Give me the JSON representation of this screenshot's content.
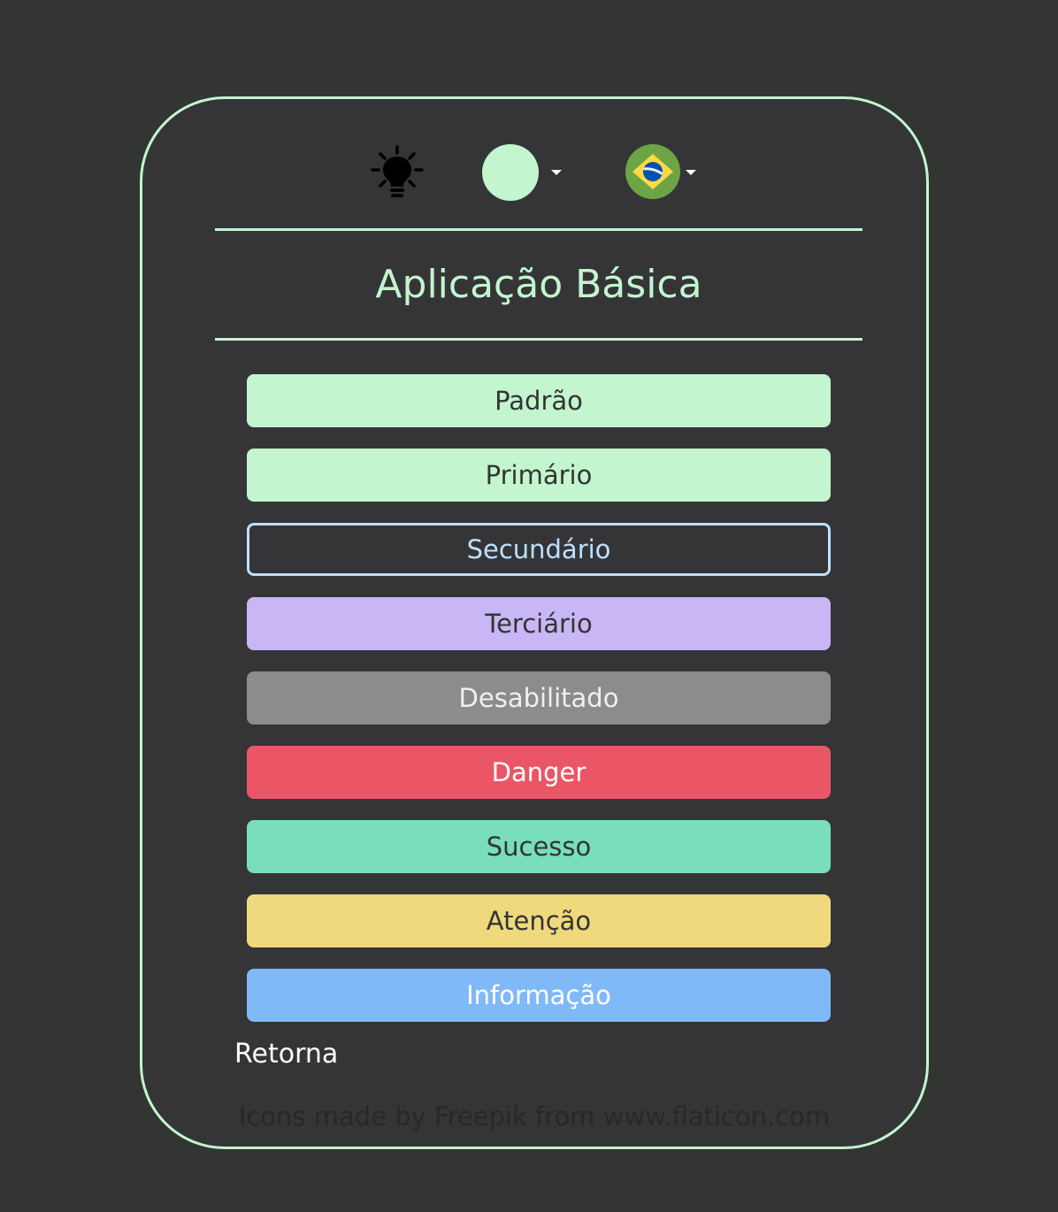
{
  "colors": {
    "background": "#333532",
    "card": "#353537",
    "accent": "#c3f5cf",
    "secondary": "#bde0fe",
    "tertiary": "#c8b6f5",
    "disabled": "#8c8c8e",
    "danger": "#ea5666",
    "success": "#78debb",
    "warning": "#f0d87c",
    "info": "#80b9f8"
  },
  "toolbar": {
    "light_icon": "lightbulb-icon",
    "theme_icon": "theme-color-circle-icon",
    "language_icon": "brazil-flag-icon",
    "dropdown_icon": "caret-down-icon"
  },
  "header": {
    "title": "Aplicação Básica"
  },
  "buttons": {
    "default": "Padrão",
    "primary": "Primário",
    "secondary": "Secundário",
    "tertiary": "Terciário",
    "disabled": "Desabilitado",
    "danger": "Danger",
    "success": "Sucesso",
    "warning": "Atenção",
    "info": "Informação"
  },
  "footer": {
    "back_link": "Retorna",
    "credits": "Icons made by Freepik from www.flaticon.com"
  }
}
